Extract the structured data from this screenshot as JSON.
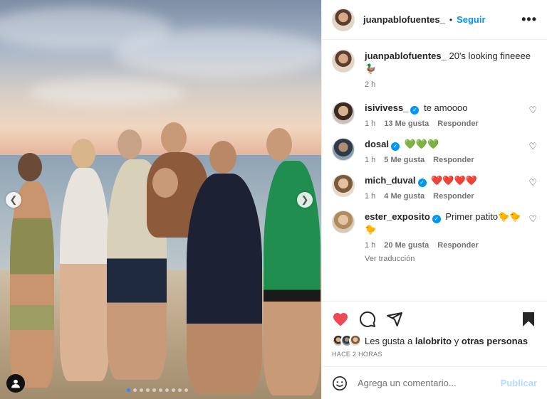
{
  "post": {
    "username": "juanpablofuentes_",
    "separator": "•",
    "follow_label": "Seguir",
    "more_label": "•••"
  },
  "caption": {
    "username": "juanpablofuentes_",
    "text": "20's looking fineeee🦆",
    "time": "2 h"
  },
  "comments": [
    {
      "username": "isivivess_",
      "verified": true,
      "text": "te amoooo",
      "time": "1 h",
      "likes": "13 Me gusta",
      "reply": "Responder",
      "translate": ""
    },
    {
      "username": "dosal",
      "verified": true,
      "text": "💚💚💚",
      "time": "1 h",
      "likes": "5 Me gusta",
      "reply": "Responder",
      "translate": ""
    },
    {
      "username": "mich_duval",
      "verified": true,
      "text": "❤️❤️❤️❤️",
      "time": "1 h",
      "likes": "4 Me gusta",
      "reply": "Responder",
      "translate": ""
    },
    {
      "username": "ester_exposito",
      "verified": true,
      "text": "Primer patito🐤🐤🐤",
      "time": "1 h",
      "likes": "20 Me gusta",
      "reply": "Responder",
      "translate": "Ver traducción"
    }
  ],
  "likes": {
    "prefix": "Les gusta a",
    "user": "lalobrito",
    "connector": "y",
    "others": "otras personas",
    "time_ago": "HACE 2 HORAS"
  },
  "comment_box": {
    "placeholder": "Agrega un comentario...",
    "publish_label": "Publicar"
  },
  "carousel": {
    "total": 10,
    "active": 1
  },
  "colors": {
    "accent": "#0095f6",
    "like_red": "#ed4956"
  }
}
